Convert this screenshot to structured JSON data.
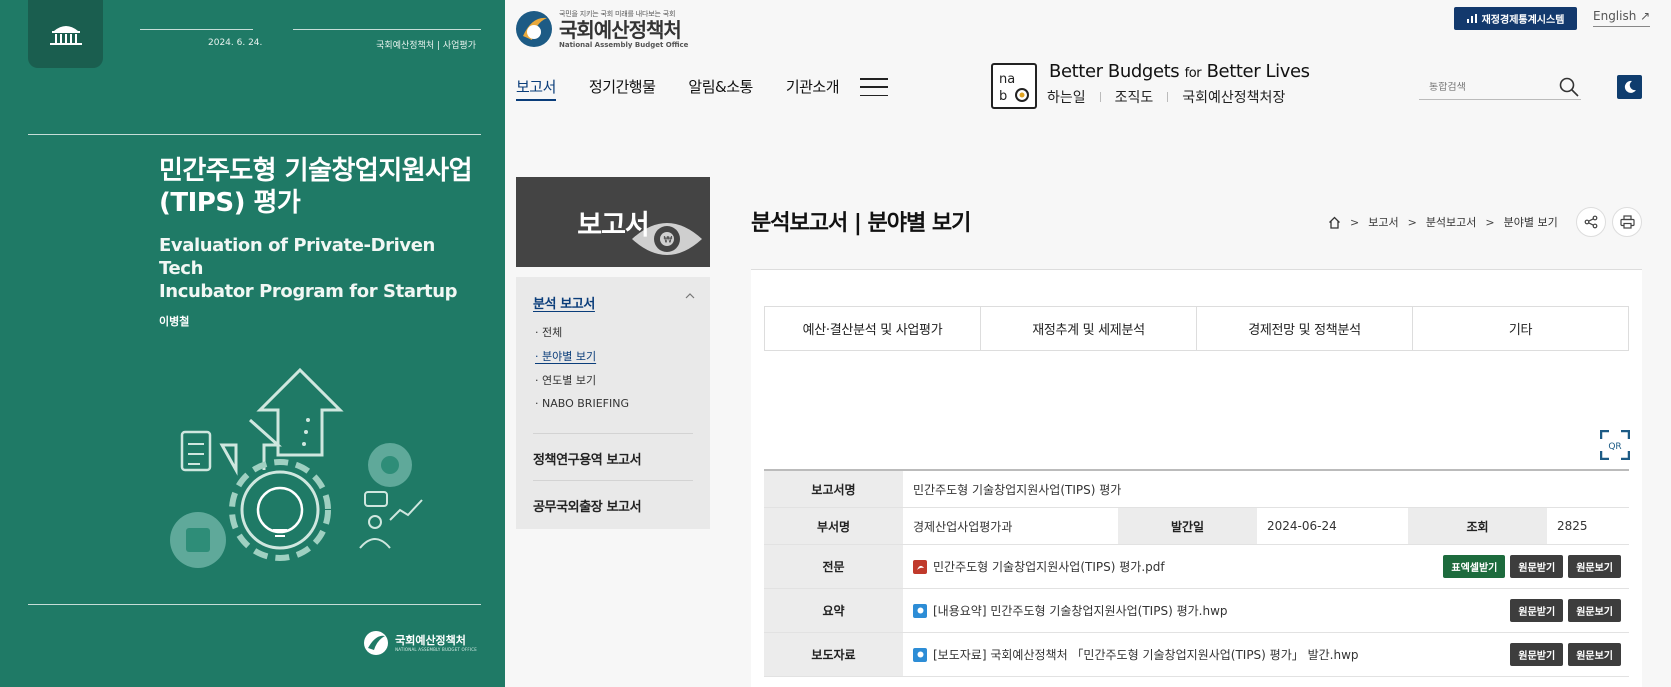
{
  "cover": {
    "date": "2024. 6. 24.",
    "org_tag": "국회예산정책처 | 사업평가",
    "title_line1": "민간주도형 기술창업지원사업",
    "title_line2": "(TIPS) 평가",
    "subtitle_line1": "Evaluation of Private-Driven Tech",
    "subtitle_line2": "Incubator Program for Startup",
    "author": "이병철",
    "logo_name": "국회예산정책처",
    "logo_sub": "NATIONAL ASSEMBLY BUDGET OFFICE",
    "bg_color": "#1f7a66"
  },
  "header": {
    "brand_slogan": "국민을 지키는 국회 미래를 내다보는 국회",
    "brand_name": "국회예산정책처",
    "brand_en": "National Assembly Budget Office",
    "gnb": [
      "보고서",
      "정기간행물",
      "알림&소통",
      "기관소개"
    ],
    "tagline_a": "Better Budgets ",
    "tagline_for": "for",
    "tagline_b": " Better Lives",
    "sublinks": [
      "하는일",
      "조직도",
      "국회예산정책처장"
    ],
    "stats_button": "재정경제통계시스템",
    "english_link": "English",
    "search_placeholder": "통합검색",
    "accent": "#0f3d6e"
  },
  "lnb": {
    "title": "보고서",
    "sections": [
      {
        "label": "분석 보고서",
        "items": [
          "전체",
          "분야별 보기",
          "연도별 보기",
          "NABO BRIEFING"
        ]
      },
      {
        "label": "정책연구용역 보고서"
      },
      {
        "label": "공무국외출장 보고서"
      }
    ]
  },
  "content": {
    "page_title": "분석보고서 | 분야별 보기",
    "breadcrumb": [
      "보고서",
      "분석보고서",
      "분야별 보기"
    ],
    "tabs": [
      "예산·결산분석 및 사업평가",
      "재정추계 및 세제분석",
      "경제전망 및 정책분석",
      "기타"
    ],
    "qr_label": "QR",
    "info": {
      "report_name_label": "보고서명",
      "report_name": "민간주도형 기술창업지원사업(TIPS) 평가",
      "dept_label": "부서명",
      "dept": "경제산업사업평가과",
      "date_label": "발간일",
      "date": "2024-06-24",
      "views_label": "조회",
      "views": "2825",
      "full_label": "전문",
      "full_file": "민간주도형 기술창업지원사업(TIPS) 평가.pdf",
      "summary_label": "요약",
      "summary_file": "[내용요약] 민간주도형 기술창업지원사업(TIPS) 평가.hwp",
      "press_label": "보도자료",
      "press_file": "[보도자료] 국회예산정책처 「민간주도형 기술창업지원사업(TIPS) 평가」 발간.hwp",
      "btn_table": "표엑셀받기",
      "btn_download": "원문받기",
      "btn_view": "원문보기"
    }
  }
}
